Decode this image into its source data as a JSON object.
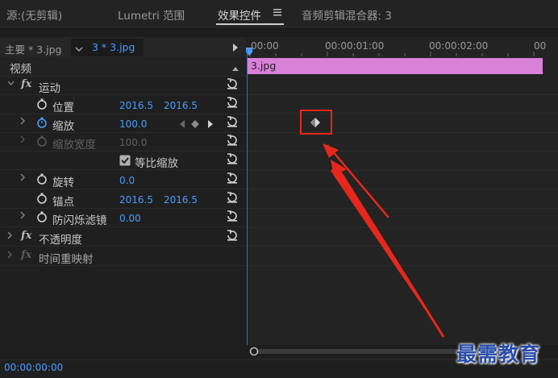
{
  "tabs": [
    {
      "label": "源:(无剪辑)"
    },
    {
      "label": "Lumetri 范围"
    },
    {
      "label": "效果控件",
      "active": true
    },
    {
      "label": "音频剪辑混合器: 3"
    }
  ],
  "clip_header": {
    "master_label": "主要 * 3.jpg",
    "sequence_label": "3 * 3.jpg"
  },
  "timeline": {
    "ruler_labels": [
      "00:00",
      "00:00:01:00",
      "00:00:02:00",
      "00"
    ],
    "clip_name": "3.jpg"
  },
  "effects": {
    "video_section": "视频",
    "motion": {
      "label": "运动",
      "position": {
        "label": "位置",
        "x": "2016.5",
        "y": "2016.5"
      },
      "scale": {
        "label": "缩放",
        "value": "100.0"
      },
      "scale_width": {
        "label": "缩放宽度",
        "value": "100.0"
      },
      "uniform_scale": {
        "label": "等比缩放",
        "checked": true
      },
      "rotation": {
        "label": "旋转",
        "value": "0.0"
      },
      "anchor": {
        "label": "锚点",
        "x": "2016.5",
        "y": "2016.5"
      },
      "anti_flicker": {
        "label": "防闪烁滤镜",
        "value": "0.00"
      }
    },
    "opacity": {
      "label": "不透明度"
    },
    "time_remap": {
      "label": "时间重映射"
    }
  },
  "status": {
    "timecode": "00:00:00:00"
  },
  "watermark": "最需教育",
  "colors": {
    "value_blue": "#4a9bff",
    "clip_pink": "#d980d9",
    "annotation_red": "#e8271c",
    "playhead_blue": "#2f6fd6"
  },
  "icons": [
    "stopwatch-icon",
    "reset-icon",
    "keyframe-diamond-icon",
    "chevron-right-icon",
    "hamburger-menu-icon",
    "play-triangle-icon"
  ]
}
